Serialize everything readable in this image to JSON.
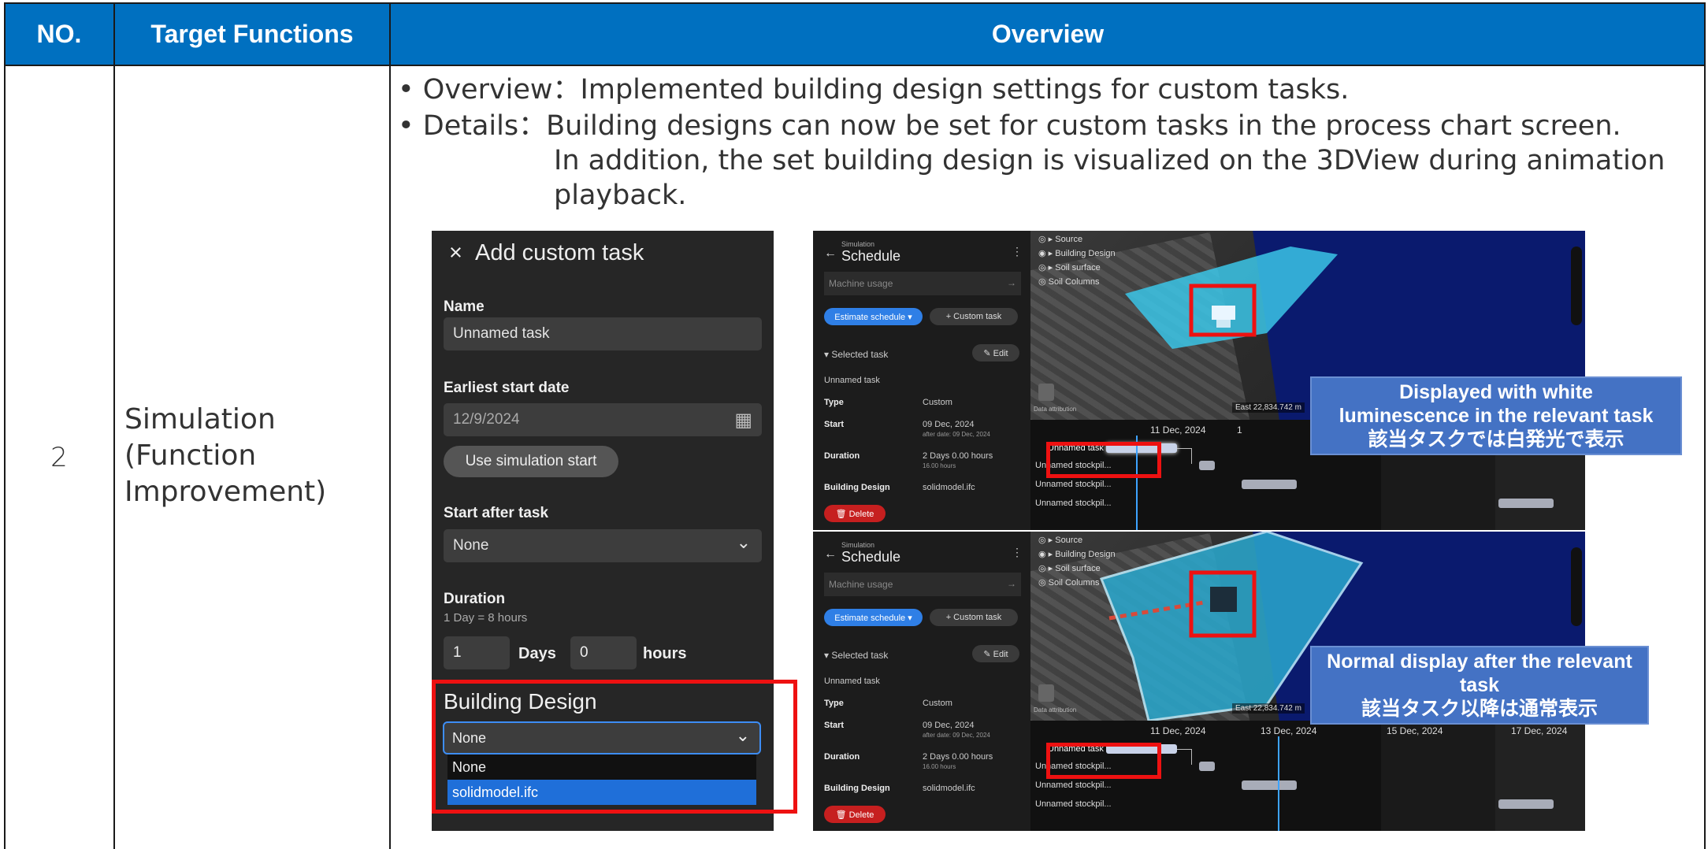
{
  "header": {
    "no": "NO.",
    "target_functions": "Target Functions",
    "overview": "Overview"
  },
  "row": {
    "no": "2",
    "target_function_lines": [
      "Simulation",
      "(Function",
      "Improvement)"
    ],
    "bullet1": "• Overview：Implemented building design settings for custom tasks.",
    "bullet2": "• Details：Building designs can now be set for custom tasks in the process chart screen.",
    "bullet2_l2": "In addition, the set building design is visualized on the 3DView during animation",
    "bullet2_l3": "playback."
  },
  "add_task": {
    "close": "×",
    "title": "Add custom task",
    "name_label": "Name",
    "name_value": "Unnamed task",
    "start_label": "Earliest start date",
    "start_value": "12/9/2024",
    "calendar_icon": "▦",
    "use_sim_start": "Use simulation start",
    "after_label": "Start after task",
    "after_value": "None",
    "chevron": "⌄",
    "duration_label": "Duration",
    "duration_hint": "1 Day = 8 hours",
    "days_value": "1",
    "days_unit": "Days",
    "hours_value": "0",
    "hours_unit": "hours",
    "bd_label": "Building Design",
    "bd_value": "None",
    "bd_options": [
      "None",
      "solidmodel.ifc"
    ]
  },
  "schedule": {
    "back": "←",
    "simulation": "Simulation",
    "title": "Schedule",
    "menu": "⋮",
    "machine_usage": "Machine usage",
    "arrow": "→",
    "estimate": "Estimate schedule ▾",
    "custom_task": "+ Custom task",
    "selected_task": "▾  Selected task",
    "edit": "✎ Edit",
    "task_name": "Unnamed task",
    "type_k": "Type",
    "type_v": "Custom",
    "start_k": "Start",
    "start_v": "09 Dec, 2024",
    "start_sub": "after date: 09 Dec, 2024",
    "duration_k": "Duration",
    "duration_v": "2 Days 0.00 hours",
    "duration_sub": "16.00 hours",
    "bd_k": "Building Design",
    "bd_v": "solidmodel.ifc",
    "delete": "🗑 Delete"
  },
  "view3d": {
    "layers": [
      "◎ ▸ Source",
      "◉ ▸ Building Design",
      "◎ ▸ Soil surface",
      "◎ Soil Columns"
    ],
    "east": "East 22,834.742 m",
    "attribution": "Data attribution"
  },
  "gantt_top": {
    "dates": [
      "11 Dec, 2024",
      "1"
    ],
    "rows": [
      "Unnamed task",
      "Unnamed stockpil...",
      "Unnamed stockpil...",
      "Unnamed stockpil..."
    ]
  },
  "gantt_bot": {
    "dates": [
      "11 Dec, 2024",
      "13 Dec, 2024",
      "15 Dec, 2024",
      "17 Dec, 2024"
    ],
    "rows": [
      "Unnamed task",
      "Unnamed stockpil...",
      "Unnamed stockpil...",
      "Unnamed stockpil..."
    ]
  },
  "callouts": {
    "c1_l1": "Displayed with white",
    "c1_l2": "luminescence in the relevant task",
    "c1_l3": "該当タスクでは白発光で表示",
    "c2_l1": "Normal display after the relevant",
    "c2_l2": "task",
    "c2_l3": "該当タスク以降は通常表示"
  },
  "colors": {
    "header_blue": "#0070c0",
    "callout_blue": "#4472c4",
    "highlight_red": "#ee1111",
    "accent_blue": "#2f7fe6"
  }
}
